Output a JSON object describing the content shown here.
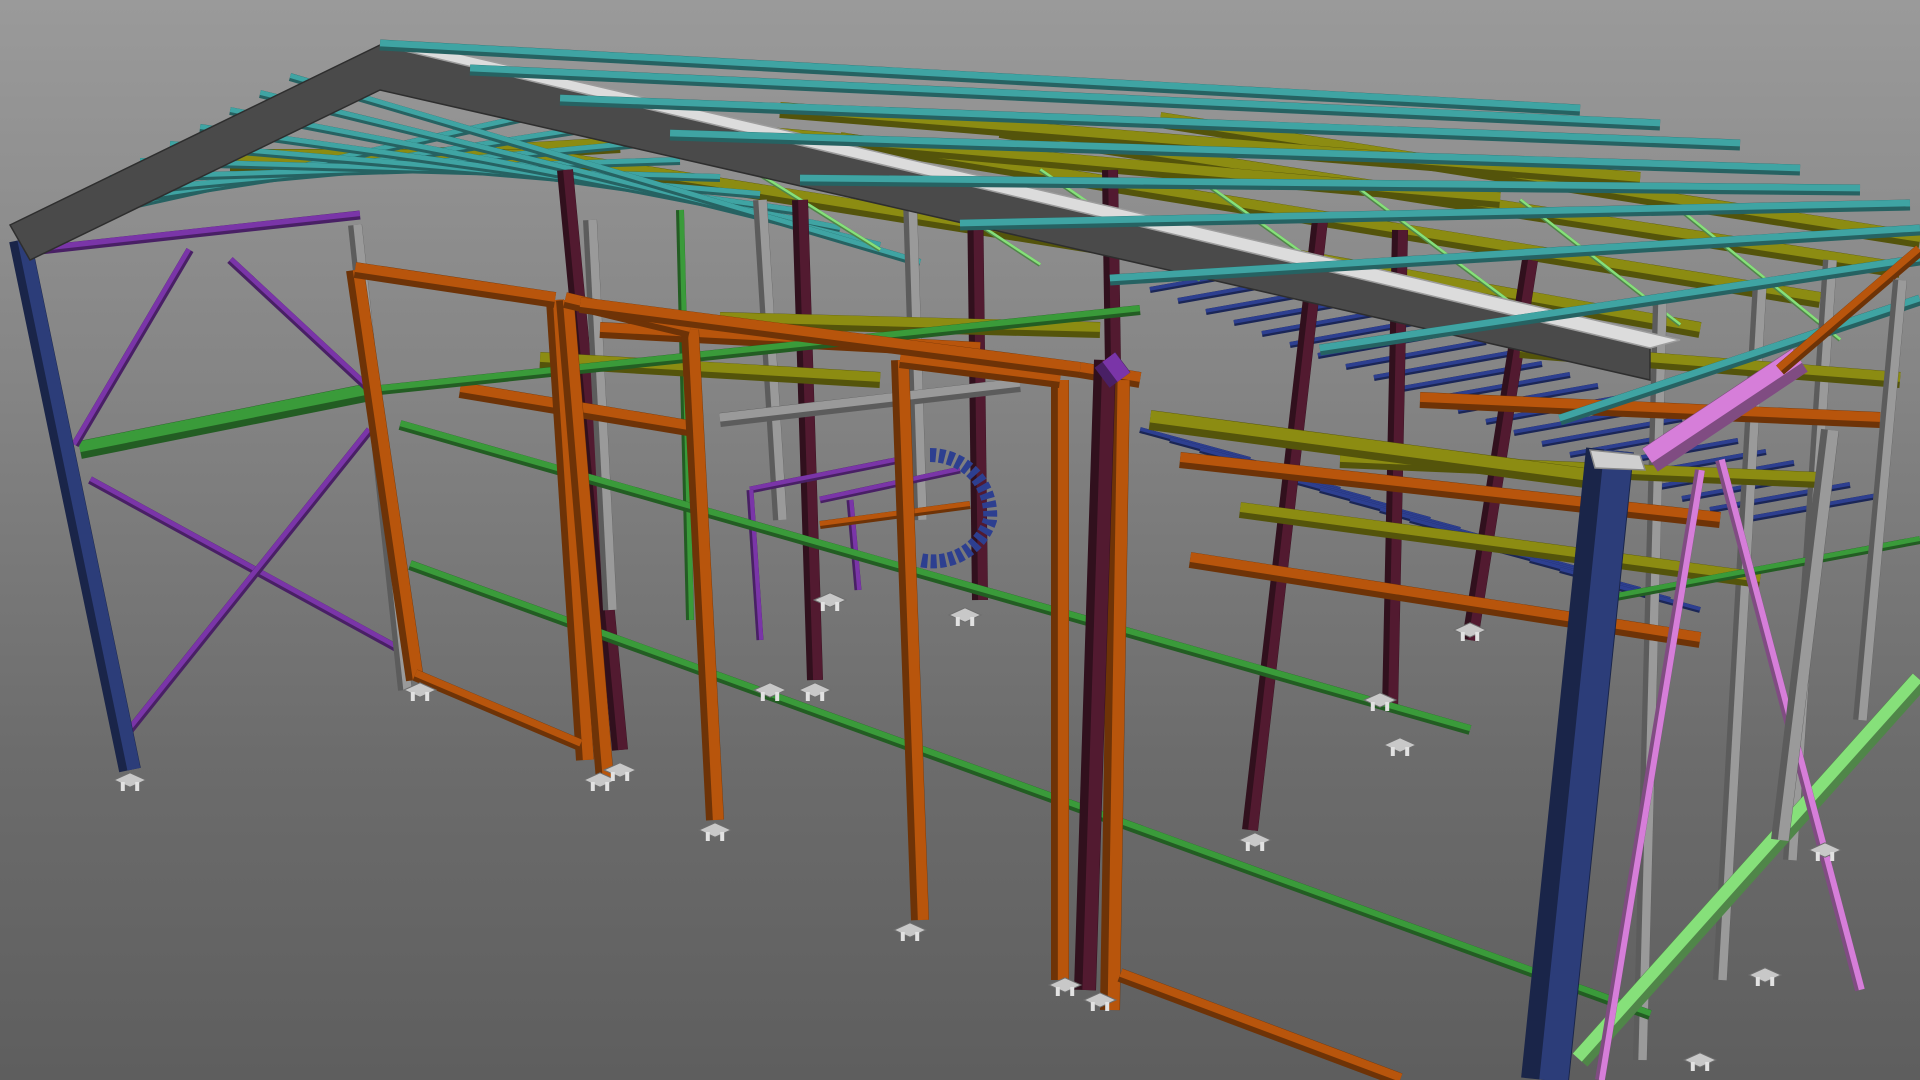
{
  "viewport": {
    "background": [
      "#9a9a9a",
      "#5e5e5e"
    ]
  },
  "colors": {
    "column_main": "#2c3d79",
    "rafter": "#4a4a4a",
    "purlin": "#3fa4a3",
    "roof_beam": "#8c8c12",
    "brace": "#7a35a8",
    "girt": "#3a9b3a",
    "door_frame": "#b8550c",
    "column_dark": "#521a30",
    "column_grey": "#9a9a9a",
    "floor_blue": "#2d3f90",
    "pink_beam": "#d67ed9",
    "light_green": "#86e07a",
    "base_plate": "#c8c8c8"
  },
  "legend_components": [
    "main-columns",
    "rafters",
    "purlins",
    "roof-beams",
    "bracing",
    "girts",
    "door-frames",
    "interior-columns",
    "mezzanine",
    "spiral-stair",
    "base-plates"
  ]
}
